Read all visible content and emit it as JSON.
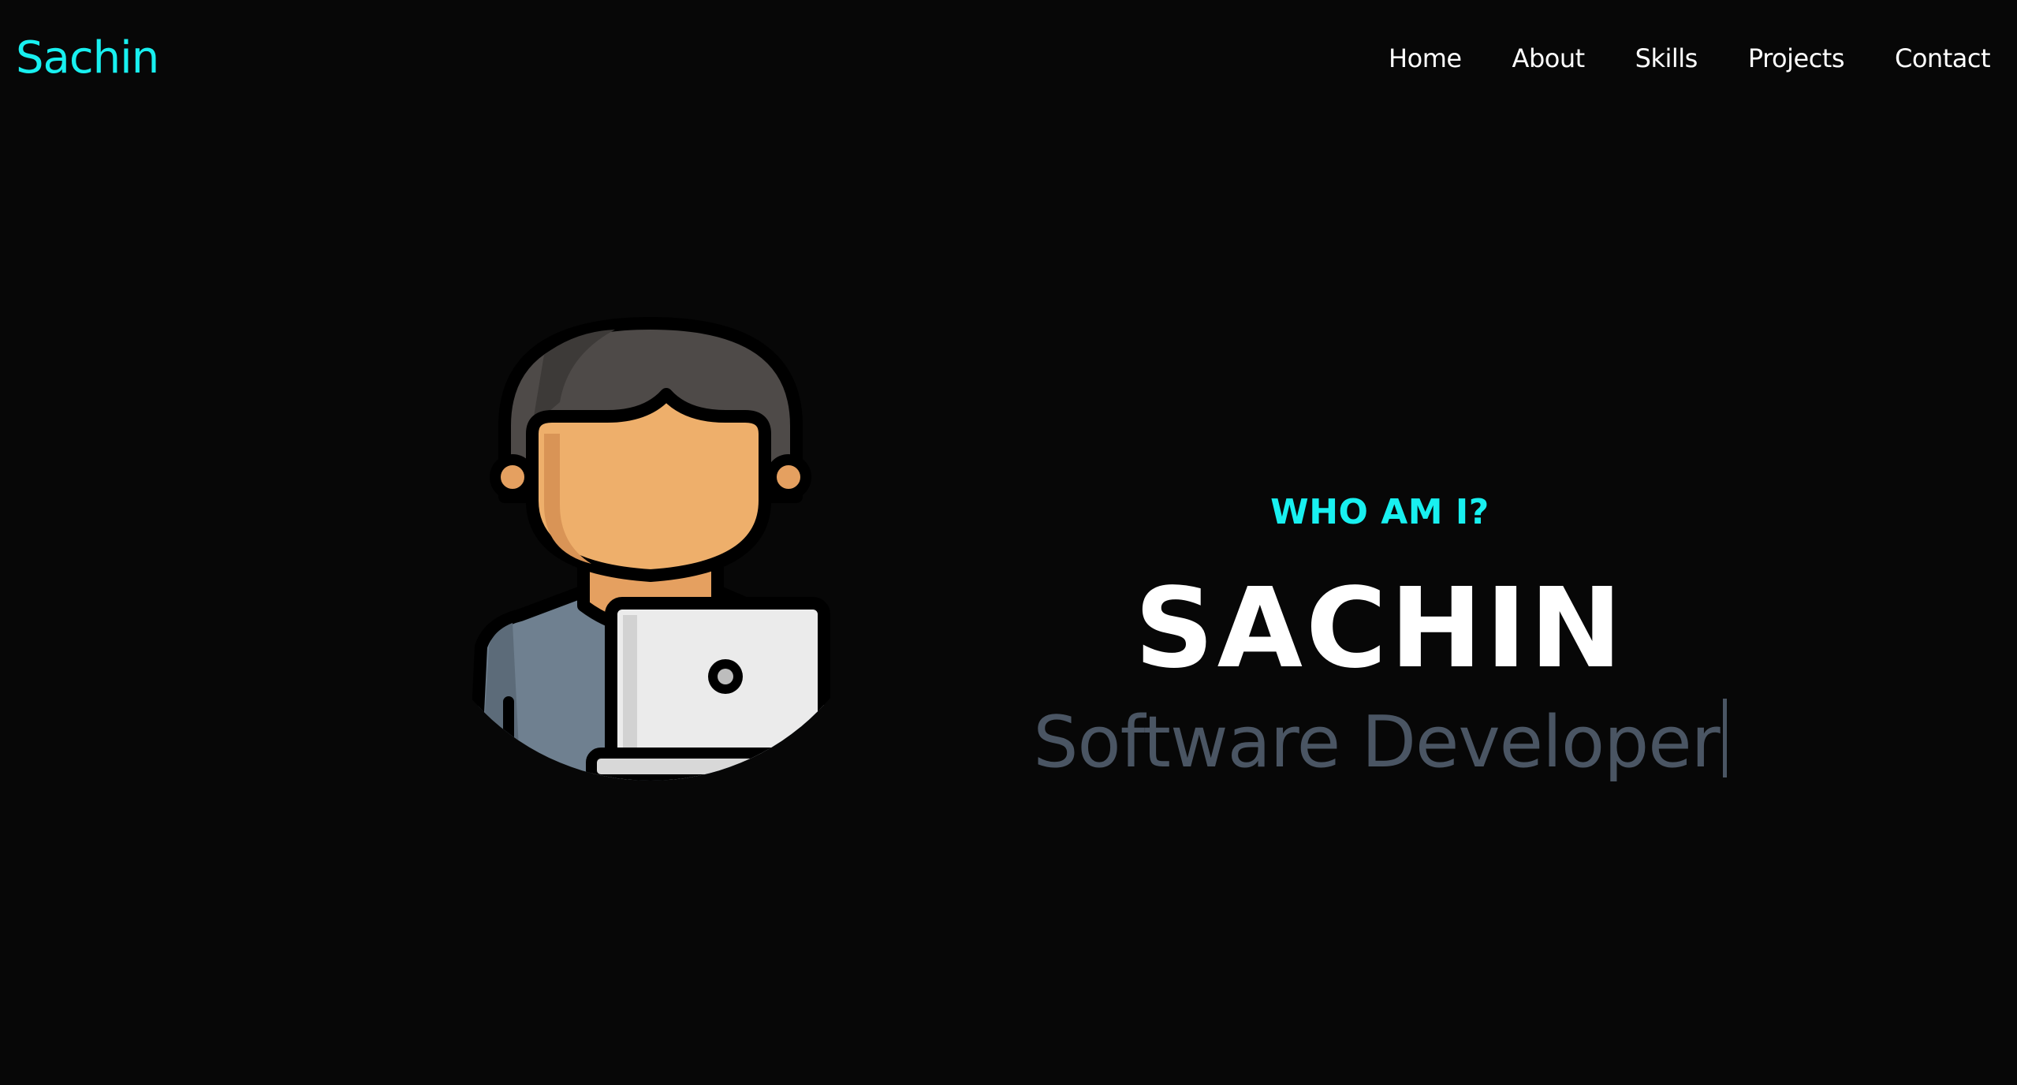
{
  "brand": "Sachin",
  "nav": {
    "items": [
      "Home",
      "About",
      "Skills",
      "Projects",
      "Contact"
    ]
  },
  "hero": {
    "eyebrow": "WHO AM I?",
    "name": "SACHIN",
    "role": "Software Developer"
  },
  "colors": {
    "background": "#070707",
    "accent": "#18f0f0",
    "role_text": "#4a5563"
  },
  "icons": {
    "avatar": "developer-with-laptop-illustration"
  }
}
